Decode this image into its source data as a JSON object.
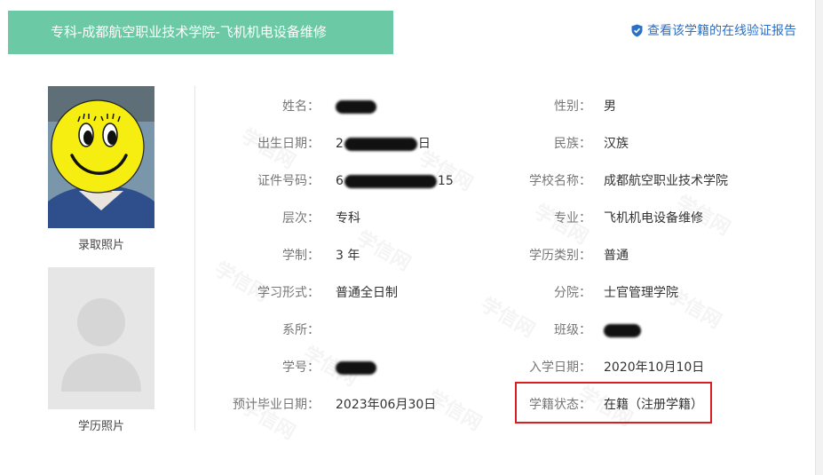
{
  "header": {
    "banner_title": "专科-成都航空职业技术学院-飞机机电设备维修",
    "verify_link": "查看该学籍的在线验证报告"
  },
  "photos": {
    "admission_caption": "录取照片",
    "diploma_caption": "学历照片"
  },
  "left_fields": [
    {
      "label": "姓名：",
      "value": ""
    },
    {
      "label": "出生日期：",
      "value_prefix": "2",
      "value_suffix": "日"
    },
    {
      "label": "证件号码：",
      "value_prefix": "6",
      "value_suffix": "15"
    },
    {
      "label": "层次：",
      "value": "专科"
    },
    {
      "label": "学制：",
      "value": "3 年"
    },
    {
      "label": "学习形式：",
      "value": "普通全日制"
    },
    {
      "label": "系所：",
      "value": ""
    },
    {
      "label": "学号：",
      "value": ""
    },
    {
      "label": "预计毕业日期：",
      "value": "2023年06月30日"
    }
  ],
  "right_fields": [
    {
      "label": "性别：",
      "value": "男"
    },
    {
      "label": "民族：",
      "value": "汉族"
    },
    {
      "label": "学校名称：",
      "value": "成都航空职业技术学院"
    },
    {
      "label": "专业：",
      "value": "飞机机电设备维修"
    },
    {
      "label": "学历类别：",
      "value": "普通"
    },
    {
      "label": "分院：",
      "value": "士官管理学院"
    },
    {
      "label": "班级：",
      "value": ""
    },
    {
      "label": "入学日期：",
      "value": "2020年10月10日"
    },
    {
      "label": "学籍状态：",
      "value": "在籍（注册学籍）"
    }
  ],
  "watermark_text": "学信网",
  "colors": {
    "banner_bg": "#6cc9a5",
    "link": "#2b70c7",
    "highlight_border": "#d81e1e"
  },
  "icons": {
    "verify": "shield-check-icon",
    "admission_photo": "smiley-face-icon",
    "diploma_photo": "person-placeholder-icon"
  }
}
